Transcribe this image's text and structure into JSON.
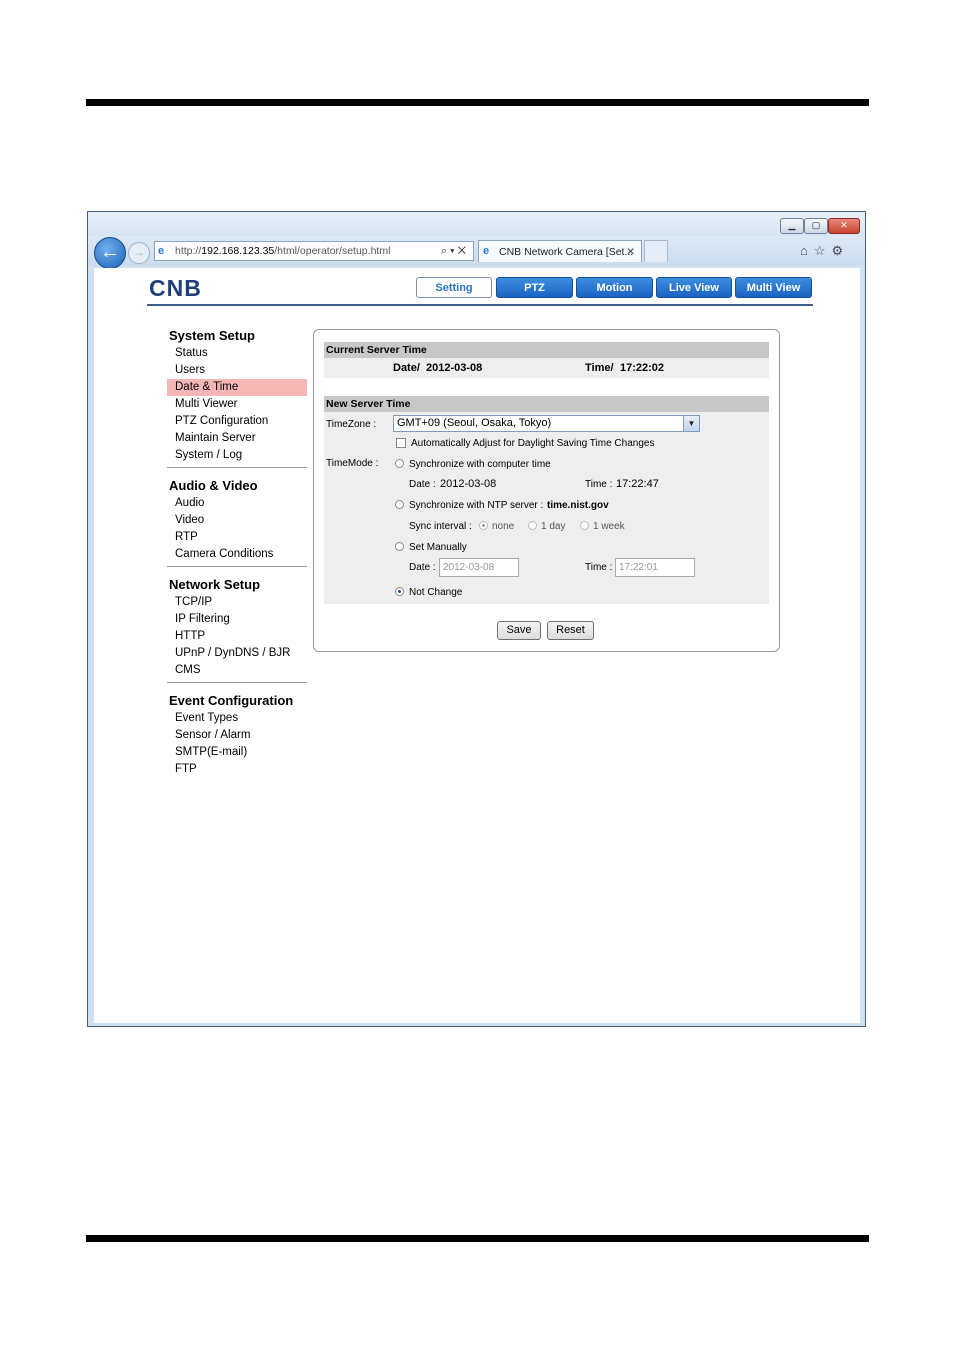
{
  "browser": {
    "url_prefix": "http://",
    "url_host": "192.168.123.35",
    "url_path": "/html/operator/setup.html",
    "tab_title": "CNB Network Camera [Set...",
    "tab_close": "✕"
  },
  "header": {
    "logo_text": "CNB",
    "tabs": [
      {
        "label": "Setting",
        "active": true
      },
      {
        "label": "PTZ",
        "active": false
      },
      {
        "label": "Motion",
        "active": false
      },
      {
        "label": "Live View",
        "active": false
      },
      {
        "label": "Multi View",
        "active": false
      }
    ]
  },
  "sidebar": {
    "sections": [
      {
        "title": "System Setup",
        "items": [
          "Status",
          "Users",
          "Date & Time",
          "Multi Viewer",
          "PTZ Configuration",
          "Maintain Server",
          "System / Log"
        ]
      },
      {
        "title": "Audio & Video",
        "items": [
          "Audio",
          "Video",
          "RTP",
          "Camera Conditions"
        ]
      },
      {
        "title": "Network Setup",
        "items": [
          "TCP/IP",
          "IP Filtering",
          "HTTP",
          "UPnP / DynDNS / BJR",
          "CMS"
        ]
      },
      {
        "title": "Event Configuration",
        "items": [
          "Event Types",
          "Sensor / Alarm",
          "SMTP(E-mail)",
          "FTP"
        ]
      }
    ],
    "selected": "Date & Time"
  },
  "current_time": {
    "heading": "Current Server Time",
    "date_label": "Date/",
    "date_value": "2012-03-08",
    "time_label": "Time/",
    "time_value": "17:22:02"
  },
  "new_time": {
    "heading": "New Server Time",
    "timezone_label": "TimeZone :",
    "timezone_value": "GMT+09 (Seoul, Osaka, Tokyo)",
    "dst_label": "Automatically Adjust for Daylight Saving Time Changes",
    "timemode_label": "TimeMode :",
    "sync_computer_label": "Synchronize with computer time",
    "computer_date_label": "Date :",
    "computer_date_value": "2012-03-08",
    "computer_time_label": "Time :",
    "computer_time_value": "17:22:47",
    "sync_ntp_label": "Synchronize with NTP server :",
    "ntp_server": "time.nist.gov",
    "sync_interval_label": "Sync interval :",
    "interval_options": [
      "none",
      "1 day",
      "1 week"
    ],
    "manual_label": "Set Manually",
    "manual_date_label": "Date :",
    "manual_date_value": "2012-03-08",
    "manual_time_label": "Time :",
    "manual_time_value": "17:22:01",
    "not_change_label": "Not Change",
    "selected_mode": "Not Change"
  },
  "actions": {
    "save": "Save",
    "reset": "Reset"
  }
}
